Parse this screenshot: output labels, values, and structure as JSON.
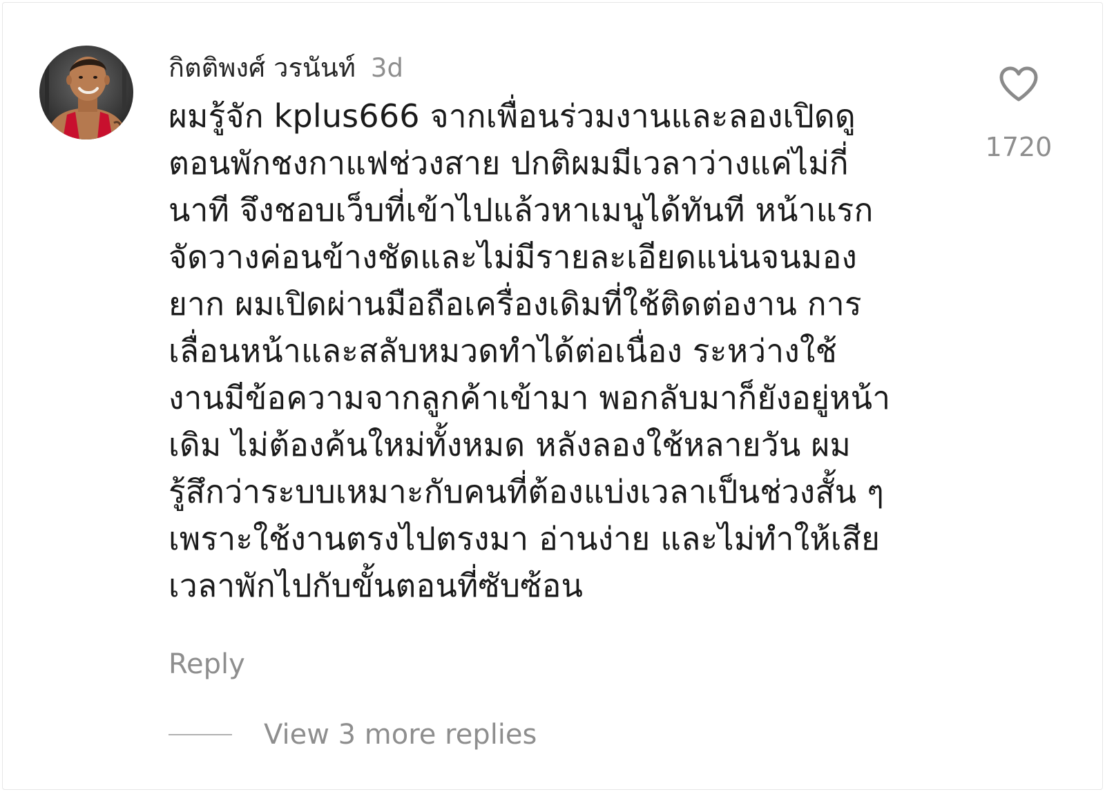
{
  "comment": {
    "username": "กิตติพงศ์ วรนันท์",
    "timestamp": "3d",
    "text_lines": [
      "ผมรู้จัก kplus666 จากเพื่อนร่วมงานและลองเปิดดู",
      "ตอนพักชงกาแฟช่วงสาย ปกติผมมีเวลาว่างแค่ไม่กี่",
      "นาที จึงชอบเว็บที่เข้าไปแล้วหาเมนูได้ทันที หน้าแรก",
      "จัดวางค่อนข้างชัดและไม่มีรายละเอียดแน่นจนมอง",
      "ยาก ผมเปิดผ่านมือถือเครื่องเดิมที่ใช้ติดต่องาน การ",
      "เลื่อนหน้าและสลับหมวดทำได้ต่อเนื่อง ระหว่างใช้",
      "งานมีข้อความจากลูกค้าเข้ามา พอกลับมาก็ยังอยู่หน้า",
      "เดิม ไม่ต้องค้นใหม่ทั้งหมด หลังลองใช้หลายวัน ผม",
      "รู้สึกว่าระบบเหมาะกับคนที่ต้องแบ่งเวลาเป็นช่วงสั้น ๆ",
      "เพราะใช้งานตรงไปตรงมา อ่านง่าย และไม่ทำให้เสีย",
      "เวลาพักไปกับขั้นตอนที่ซับซ้อน"
    ],
    "likes": "1720",
    "reply_label": "Reply",
    "view_replies_label": "View 3 more replies",
    "like_icon": "heart-outline-icon"
  },
  "colors": {
    "text": "#1a1a1a",
    "muted": "#8e8e8e",
    "divider": "#b0b0b0"
  }
}
